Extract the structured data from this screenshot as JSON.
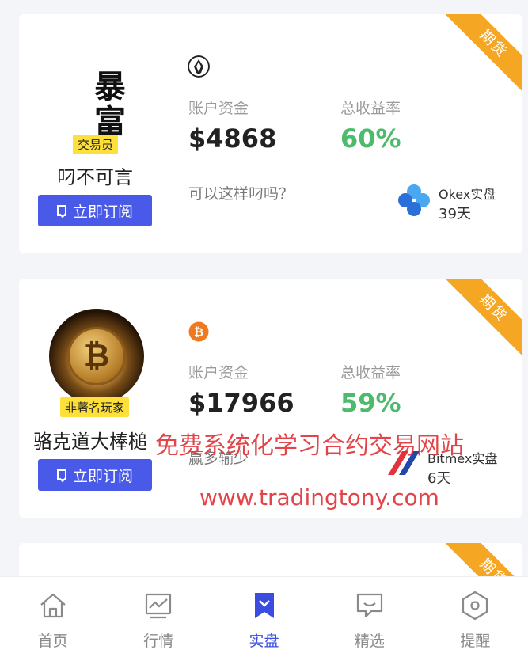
{
  "corner_tag": "期货",
  "subscribe_label": "立即订阅",
  "fund_label": "账户资金",
  "yield_label": "总收益率",
  "cards": [
    {
      "avatar_text": [
        "暴",
        "富"
      ],
      "role_badge": "交易员",
      "name": "叼不可言",
      "fund": "$4868",
      "yield": "60%",
      "motto": "可以这样叼吗？",
      "platform": "Okex实盘",
      "days": "39天",
      "coin_icon": "eos-coin-icon",
      "platform_icon": "okex-logo-icon"
    },
    {
      "avatar_text": [
        "₿"
      ],
      "role_badge": "非著名玩家",
      "name": "骆克道大棒槌",
      "fund": "$17966",
      "yield": "59%",
      "motto": "赢多输少",
      "platform": "Bitmex实盘",
      "days": "6天",
      "coin_icon": "bitcoin-coin-icon",
      "platform_icon": "bitmex-logo-icon"
    }
  ],
  "watermark": {
    "line1": "免费系统化学习合约交易网站",
    "line2": "www.tradingtony.com"
  },
  "tabs": [
    {
      "label": "首页",
      "icon": "home-icon",
      "active": false
    },
    {
      "label": "行情",
      "icon": "chart-icon",
      "active": false
    },
    {
      "label": "实盘",
      "icon": "bookmark-icon",
      "active": true
    },
    {
      "label": "精选",
      "icon": "message-icon",
      "active": false
    },
    {
      "label": "提醒",
      "icon": "hexagon-icon",
      "active": false
    }
  ],
  "colors": {
    "accent": "#3a4de0",
    "button": "#4a5ae8",
    "ribbon": "#f5a623",
    "positive": "#4cbb6c",
    "badge": "#fde13a",
    "watermark": "#e0353a"
  }
}
